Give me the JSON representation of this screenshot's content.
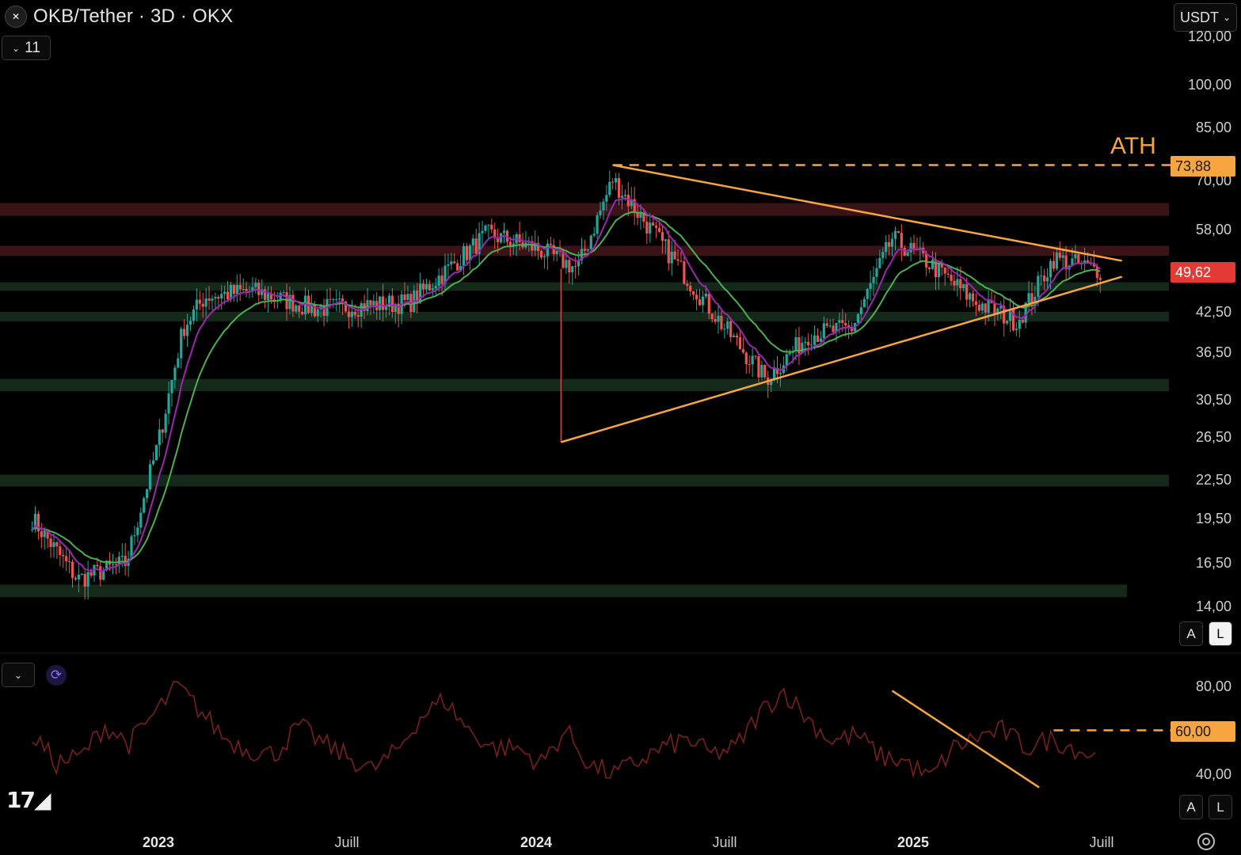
{
  "header": {
    "symbol_title": "OKB/Tether · 3D · OKX",
    "indicator_count": "11",
    "currency_button": "USDT"
  },
  "price_axis": {
    "labels": [
      "120,00",
      "100,00",
      "85,00",
      "70,00",
      "58,00",
      "42,50",
      "36,50",
      "30,50",
      "26,50",
      "22,50",
      "19,50",
      "16,50",
      "14,00"
    ],
    "scale_buttons": {
      "auto": "A",
      "log": "L"
    }
  },
  "price_tags": {
    "ath_value": "73,88",
    "current_value": "49,62",
    "ath_text": "ATH"
  },
  "rsi_axis": {
    "labels": [
      "80,00",
      "40,00"
    ],
    "tag_value": "60,00",
    "scale_buttons": {
      "auto": "A",
      "log": "L"
    }
  },
  "time_axis": {
    "labels": [
      "2023",
      "Juill",
      "2024",
      "Juill",
      "2025",
      "Juill"
    ]
  },
  "colors": {
    "background": "#000000",
    "bull_candle": "#26a69a",
    "bear_candle": "#ef5350",
    "ema_fast": "#9c27b0",
    "ema_slow": "#4caf50",
    "trendline": "#f7a541",
    "resistance_zone": "#3a1316",
    "support_zone": "#15291a",
    "rsi_line": "#7a1e1e",
    "current_tag": "#e53935",
    "ath_tag": "#f7a541"
  },
  "chart_data": [
    {
      "type": "candlestick",
      "symbol": "OKB/Tether",
      "timeframe": "3D",
      "exchange": "OKX",
      "y_scale": "log",
      "ylim": [
        13.5,
        125
      ],
      "x_range": [
        "2022-09-01",
        "2025-07-31"
      ],
      "ath": 73.88,
      "last_price": 49.62,
      "approx_close_path": [
        {
          "date": "2022-09-01",
          "close": 19.5
        },
        {
          "date": "2022-10-15",
          "close": 15.5
        },
        {
          "date": "2022-12-01",
          "close": 16.5
        },
        {
          "date": "2023-01-01",
          "close": 26
        },
        {
          "date": "2023-01-25",
          "close": 40
        },
        {
          "date": "2023-02-15",
          "close": 45
        },
        {
          "date": "2023-04-01",
          "close": 46
        },
        {
          "date": "2023-06-01",
          "close": 43
        },
        {
          "date": "2023-09-01",
          "close": 44
        },
        {
          "date": "2023-11-15",
          "close": 57
        },
        {
          "date": "2024-01-01",
          "close": 54
        },
        {
          "date": "2024-02-10",
          "close": 50
        },
        {
          "date": "2024-03-15",
          "close": 70
        },
        {
          "date": "2024-05-01",
          "close": 55
        },
        {
          "date": "2024-07-01",
          "close": 40
        },
        {
          "date": "2024-08-10",
          "close": 33
        },
        {
          "date": "2024-09-20",
          "close": 39
        },
        {
          "date": "2024-11-01",
          "close": 40
        },
        {
          "date": "2024-12-10",
          "close": 56
        },
        {
          "date": "2025-01-15",
          "close": 51
        },
        {
          "date": "2025-03-01",
          "close": 44
        },
        {
          "date": "2025-04-10",
          "close": 41
        },
        {
          "date": "2025-05-15",
          "close": 52
        },
        {
          "date": "2025-07-01",
          "close": 49.62
        }
      ],
      "horizontal_zones": [
        {
          "kind": "resistance",
          "low": 61,
          "high": 64
        },
        {
          "kind": "resistance",
          "low": 52.5,
          "high": 54.5
        },
        {
          "kind": "support",
          "low": 46,
          "high": 47.5
        },
        {
          "kind": "support",
          "low": 41,
          "high": 42.5
        },
        {
          "kind": "support",
          "low": 31.5,
          "high": 33
        },
        {
          "kind": "support",
          "low": 22,
          "high": 23
        },
        {
          "kind": "support",
          "low": 14.5,
          "high": 15.2
        }
      ],
      "drawings": [
        {
          "kind": "dashed_level",
          "value": 73.88,
          "label": "ATH"
        },
        {
          "kind": "trendline",
          "from": {
            "date": "2024-03-15",
            "value": 73.88
          },
          "to": {
            "date": "2025-07-20",
            "value": 51.5
          }
        },
        {
          "kind": "trendline",
          "from": {
            "date": "2024-01-25",
            "value": 26
          },
          "to": {
            "date": "2025-07-20",
            "value": 48.5
          }
        }
      ],
      "moving_averages": [
        "fast",
        "slow"
      ]
    },
    {
      "type": "line",
      "name": "RSI",
      "ylim": [
        30,
        95
      ],
      "values_approx": [
        58,
        45,
        48,
        62,
        54,
        67,
        80,
        68,
        56,
        51,
        49,
        62,
        54,
        48,
        42,
        50,
        66,
        74,
        60,
        52,
        52,
        45,
        60,
        44,
        40,
        46,
        52,
        56,
        49,
        52,
        68,
        78,
        65,
        55,
        58,
        48,
        46,
        38,
        52,
        57,
        60,
        52,
        56,
        52,
        47
      ],
      "drawings": [
        {
          "kind": "dashed_level",
          "value": 60
        },
        {
          "kind": "trendline",
          "from": {
            "date": "2024-12-10",
            "value": 78
          },
          "to": {
            "date": "2025-05-01",
            "value": 34
          }
        }
      ]
    }
  ]
}
